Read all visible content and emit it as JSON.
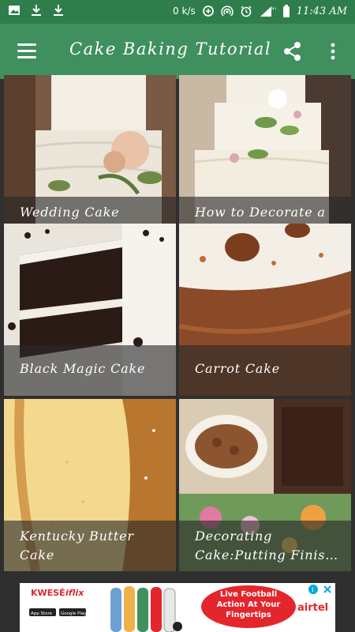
{
  "status_bar": {
    "speed": "0 k/s",
    "time": "11:43 AM",
    "network": "H+",
    "icons": [
      "image-icon",
      "download-icon",
      "download-icon",
      "data-saver-icon",
      "hotspot-icon",
      "alarm-icon",
      "signal-icon",
      "battery-icon"
    ]
  },
  "app_bar": {
    "title": "Cake Baking Tutorial",
    "icons": [
      "menu-icon",
      "share-icon",
      "more-vert-icon"
    ]
  },
  "tiles": [
    {
      "label": "Wedding Cake Frosting"
    },
    {
      "label": "How to Decorate a Wedding Cake"
    },
    {
      "label": "Black Magic Cake"
    },
    {
      "label": "Carrot Cake"
    },
    {
      "label": "Kentucky Butter Cake"
    },
    {
      "label": "Decorating Cake:Putting Finis…"
    }
  ],
  "ad": {
    "brand1": "KWESÉ",
    "brand2": "iflix",
    "headline": "Live Football Action At Your Fingertips",
    "brand3": "airtel",
    "store1": "App Store",
    "store2": "Google Play"
  },
  "colors": {
    "status_bar": "#2e7d4a",
    "app_bar": "#3f8f5f",
    "background": "#2f2f2f",
    "ad_red": "#e3262c"
  }
}
